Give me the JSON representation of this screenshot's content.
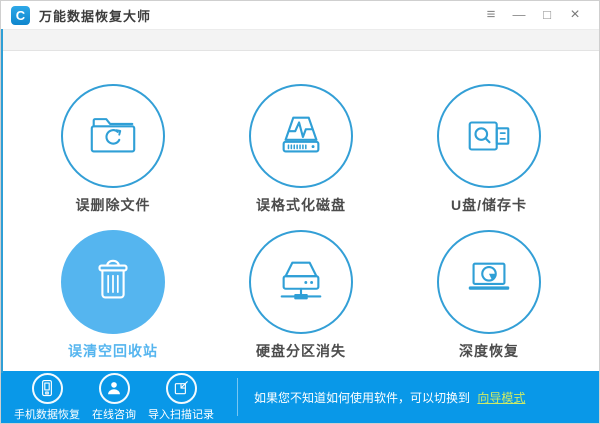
{
  "window": {
    "title": "万能数据恢复大师",
    "logo_glyph": "C",
    "controls": [
      {
        "name": "menu-icon",
        "glyph": "≡"
      },
      {
        "name": "minimize-icon",
        "glyph": "—"
      },
      {
        "name": "maximize-icon",
        "glyph": "□"
      },
      {
        "name": "close-icon",
        "glyph": "×"
      }
    ]
  },
  "colors": {
    "accent_blue": "#0998e8",
    "active_blue": "#55b5ef",
    "circle_outline": "#339fd6",
    "link_green": "#cdea67"
  },
  "main": {
    "items": [
      {
        "label": "误删除文件",
        "icon": "folder-recycle-icon",
        "active": false
      },
      {
        "label": "误格式化磁盘",
        "icon": "format-disk-icon",
        "active": false
      },
      {
        "label": "U盘/储存卡",
        "icon": "usb-storage-icon",
        "active": false
      },
      {
        "label": "误清空回收站",
        "icon": "trash-bin-icon",
        "active": true
      },
      {
        "label": "硬盘分区消失",
        "icon": "disk-partition-icon",
        "active": false
      },
      {
        "label": "深度恢复",
        "icon": "deep-recovery-monitor-icon",
        "active": false
      }
    ]
  },
  "footer": {
    "items": [
      {
        "label": "手机数据恢复",
        "icon": "phone-icon"
      },
      {
        "label": "在线咨询",
        "icon": "person-icon"
      },
      {
        "label": "导入扫描记录",
        "icon": "import-icon"
      }
    ],
    "hint_text": "如果您不知道如何使用软件，可以切换到",
    "link_label": "向导模式"
  }
}
